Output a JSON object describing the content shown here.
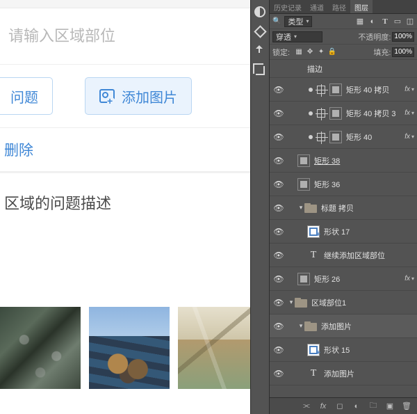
{
  "left": {
    "region_placeholder": "请输入区域部位",
    "btn_problem": "问题",
    "btn_add_image": "添加图片",
    "btn_delete": "删除",
    "desc_title": "区域的问题描述"
  },
  "mid_tools": {
    "items": [
      "bw-circle",
      "rotate-color",
      "move-arrow",
      "crop"
    ]
  },
  "panel": {
    "tabs": [
      "历史记录",
      "通道",
      "路径",
      "图层"
    ],
    "active_tab_index": 3,
    "filter": {
      "kind_label": "类型"
    },
    "blend": {
      "mode": "穿透",
      "opacity_label": "不透明度:",
      "opacity_value": "100%"
    },
    "lock": {
      "lead": "锁定:",
      "fill_label": "填充:",
      "fill_value": "100%"
    },
    "layers": [
      {
        "eye": false,
        "indent": 2,
        "type": "effect-label",
        "name": "描边"
      },
      {
        "eye": true,
        "indent": 2,
        "link": true,
        "target": true,
        "type": "shape",
        "name": "矩形 40 拷贝",
        "fx": true
      },
      {
        "eye": true,
        "indent": 2,
        "link": true,
        "target": true,
        "type": "shape",
        "name": "矩形 40 拷贝 3",
        "fx": true
      },
      {
        "eye": true,
        "indent": 2,
        "link": true,
        "target": true,
        "type": "shape",
        "name": "矩形 40",
        "fx": true
      },
      {
        "eye": true,
        "indent": 1,
        "type": "shape",
        "name": "矩形 38",
        "underline": true
      },
      {
        "eye": true,
        "indent": 1,
        "type": "shape",
        "name": "矩形 36"
      },
      {
        "eye": true,
        "indent": 1,
        "fold": "open",
        "type": "folder",
        "name": "标题 拷贝"
      },
      {
        "eye": true,
        "indent": 2,
        "type": "icon-img",
        "name": "形状 17"
      },
      {
        "eye": true,
        "indent": 2,
        "type": "text",
        "name": "继续添加区域部位"
      },
      {
        "eye": true,
        "indent": 1,
        "type": "shape",
        "name": "矩形 26",
        "fx": true
      },
      {
        "eye": true,
        "indent": 0,
        "fold": "open",
        "type": "folder",
        "name": "区域部位1"
      },
      {
        "eye": true,
        "indent": 1,
        "fold": "open",
        "type": "folder",
        "name": "添加图片",
        "selected": true
      },
      {
        "eye": true,
        "indent": 2,
        "type": "icon-img",
        "name": "形状 15"
      },
      {
        "eye": true,
        "indent": 2,
        "type": "text",
        "name": "添加图片"
      }
    ],
    "footer_icons": [
      "link",
      "fx",
      "mask",
      "adjust",
      "group",
      "new",
      "trash"
    ]
  }
}
